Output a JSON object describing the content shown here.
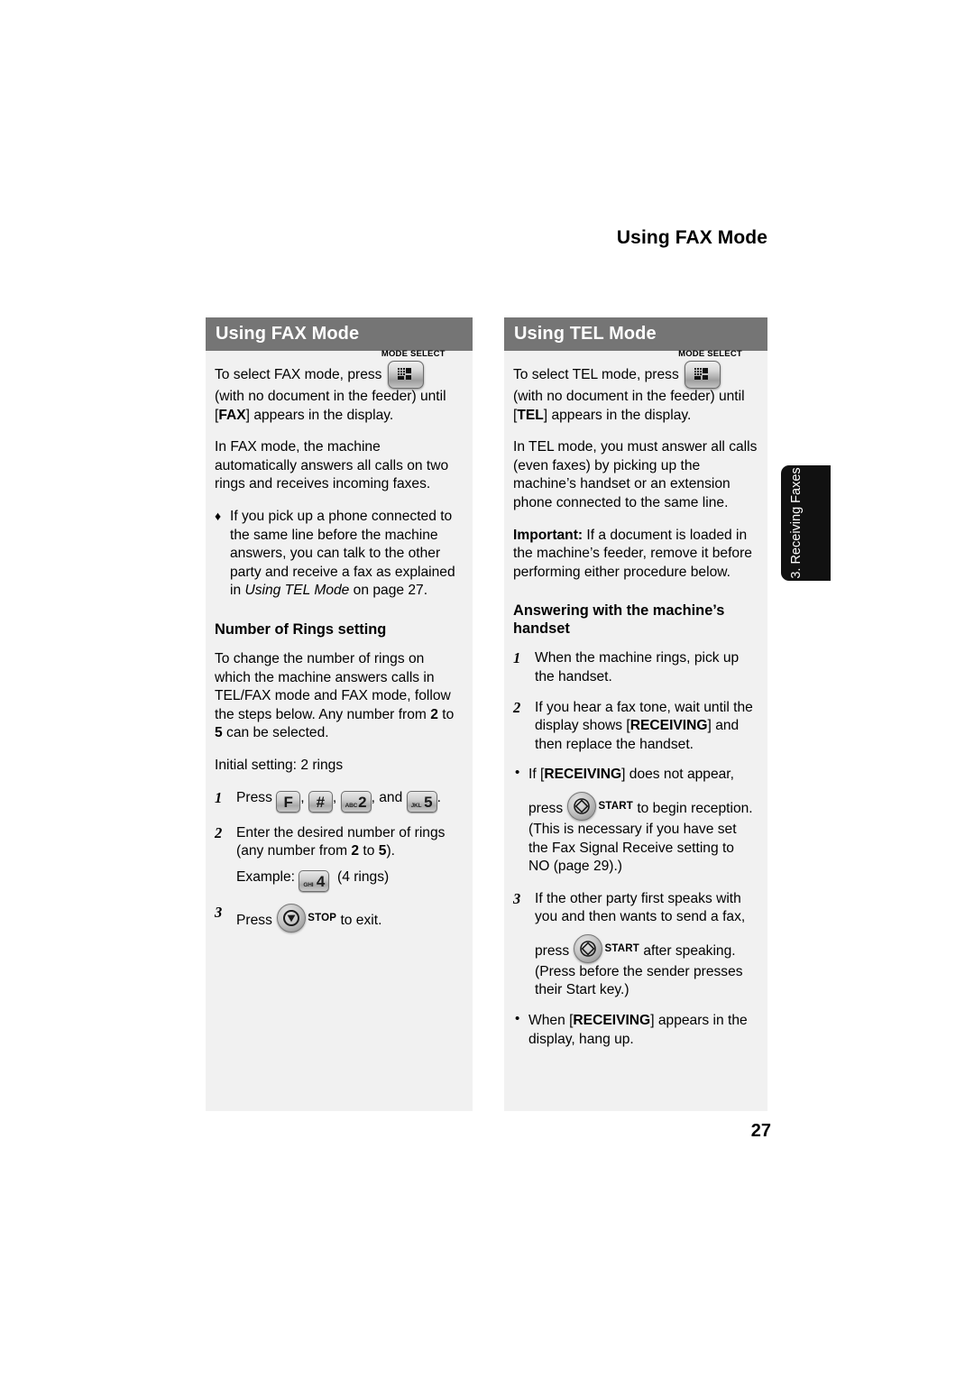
{
  "page": {
    "running_head": "Using FAX Mode",
    "page_number": "27",
    "side_tab": "3. Receiving Faxes",
    "colors": {
      "panel_header_bg": "#757575",
      "panel_body_bg": "#f1f1f1",
      "side_tab_bg": "#111111",
      "text": "#000000"
    }
  },
  "left_panel": {
    "header": "Using FAX Mode",
    "intro_prefix": "To select FAX mode, press",
    "mode_select_label": "MODE SELECT",
    "intro_suffix_line1": "(with no document in the feeder) until",
    "intro_suffix_line2_pre": "[",
    "intro_suffix_bold": "FAX",
    "intro_suffix_line2_post": "] appears in the display.",
    "para_mode": "In FAX mode, the machine automatically answers all calls on two rings and receives incoming faxes.",
    "bullet_marker": "♦",
    "bullet_text_pre": "If you pick up a phone connected to the same line before the machine answers, you can talk to the other party and receive a fax as explained in ",
    "bullet_text_italic": "Using TEL Mode",
    "bullet_text_post": " on page 27.",
    "sub_head": "Number of Rings setting",
    "para_change_pre": "To change the number of rings on which the machine answers calls in TEL/FAX mode and FAX mode, follow the steps below. Any number from ",
    "para_change_b1": "2",
    "para_change_mid": " to ",
    "para_change_b2": "5",
    "para_change_post": " can be selected.",
    "initial_setting": "Initial setting: 2 rings",
    "steps": [
      {
        "num": "1",
        "press_label": "Press",
        "keys": [
          {
            "letters": "",
            "digit": "F"
          },
          {
            "letters": "",
            "digit": "#"
          },
          {
            "letters": "ABC",
            "digit": "2"
          },
          {
            "letters": "JKL",
            "digit": "5"
          }
        ],
        "and_label": ", and",
        "end_label": "."
      },
      {
        "num": "2",
        "line1_pre": "Enter the desired number of rings (any number from ",
        "line1_b1": "2",
        "line1_mid": " to ",
        "line1_b2": "5",
        "line1_post": ").",
        "example_label": "Example:",
        "example_key": {
          "letters": "GHI",
          "digit": "4"
        },
        "example_note": "(4 rings)"
      },
      {
        "num": "3",
        "press_label": "Press",
        "stop_key_cap": "STOP",
        "end_label": "to exit."
      }
    ]
  },
  "right_panel": {
    "header": "Using TEL Mode",
    "intro_prefix": "To select TEL mode, press",
    "mode_select_label": "MODE SELECT",
    "intro_suffix_line1": "(with no document in the feeder) until",
    "intro_suffix_bold": "TEL",
    "intro_suffix_line2_post": "] appears in the display.",
    "para_mode": "In TEL mode, you must answer all calls (even faxes) by picking up the machine’s handset or an extension phone connected to the same line.",
    "important_label": "Important:",
    "important_text": " If a document is loaded in the machine’s feeder, remove it before performing either procedure below.",
    "sub_head": "Answering with the machine’s handset",
    "bullet_marker": "•",
    "steps": [
      {
        "num": "1",
        "text": "When the machine rings, pick up the handset."
      },
      {
        "num": "2",
        "text_pre": "If you hear a fax tone, wait until the display shows [",
        "text_bold": "RECEIVING",
        "text_post": "] and then replace the handset."
      },
      {
        "num": "3",
        "text": "If the other party first speaks with you and then wants to send a fax,",
        "press_label": "press",
        "start_key_cap": "START",
        "after_label": "after speaking.",
        "note": "(Press before the sender presses their Start key.)"
      }
    ],
    "bullets": [
      {
        "text_pre": "If [",
        "text_bold": "RECEIVING",
        "text_post": "] does not appear,",
        "press_label": "press",
        "start_key_cap": "START",
        "after_label": "to begin reception.",
        "note": "(This is necessary if you have set the Fax Signal Receive setting to NO (page 29).)"
      },
      {
        "text_pre": "When [",
        "text_bold": "RECEIVING",
        "text_post": "] appears in the display, hang up."
      }
    ]
  }
}
